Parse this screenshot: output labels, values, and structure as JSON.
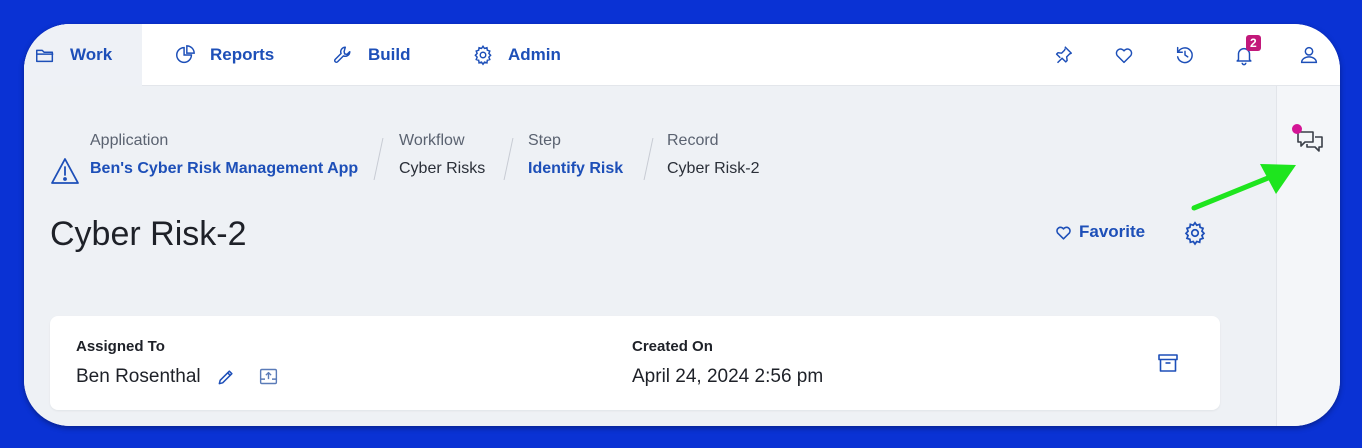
{
  "nav": {
    "work": "Work",
    "reports": "Reports",
    "build": "Build",
    "admin": "Admin",
    "notification_count": "2"
  },
  "breadcrumb": {
    "application_label": "Application",
    "application_value": "Ben's Cyber Risk Management App",
    "workflow_label": "Workflow",
    "workflow_value": "Cyber Risks",
    "step_label": "Step",
    "step_value": "Identify Risk",
    "record_label": "Record",
    "record_value": "Cyber Risk-2"
  },
  "page": {
    "title": "Cyber Risk-2",
    "favorite_label": "Favorite"
  },
  "record": {
    "assigned_label": "Assigned To",
    "assigned_value": "Ben Rosenthal",
    "created_label": "Created On",
    "created_value": "April 24, 2024 2:56 pm"
  },
  "colors": {
    "accent": "#1d4fb8",
    "badge": "#c2187a",
    "annotation_arrow": "#1ee51e",
    "outer_border": "#0a32d4"
  },
  "icons": [
    "folder-icon",
    "pie-chart-icon",
    "wrench-icon",
    "gear-icon",
    "pin-icon",
    "heart-icon",
    "history-icon",
    "bell-icon",
    "user-icon",
    "chat-icon",
    "warning-icon",
    "pencil-icon",
    "export-icon",
    "archive-icon"
  ]
}
